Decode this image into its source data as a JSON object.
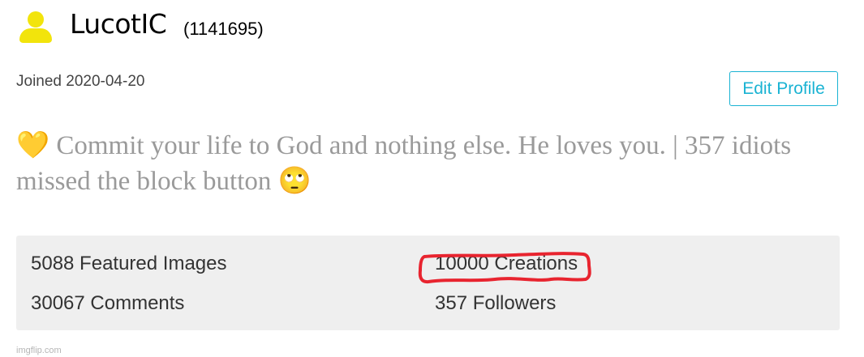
{
  "profile": {
    "username": "LucotIC",
    "user_id": "(1141695)",
    "joined": "Joined 2020-04-20",
    "edit_button": "Edit Profile",
    "bio_emoji_start": "💛",
    "bio_text": " Commit your life to God and nothing else. He loves you. | 357 idiots missed the block button ",
    "bio_emoji_end": "🙄"
  },
  "stats": {
    "featured": "5088 Featured Images",
    "creations": "10000 Creations",
    "comments": "30067 Comments",
    "followers": "357 Followers"
  },
  "watermark": "imgflip.com",
  "colors": {
    "avatar": "#f2e40c",
    "accent": "#1ab3d3",
    "highlight": "#e8242f",
    "stats_bg": "#efefef"
  },
  "icons": {
    "avatar": "user-avatar-icon"
  }
}
